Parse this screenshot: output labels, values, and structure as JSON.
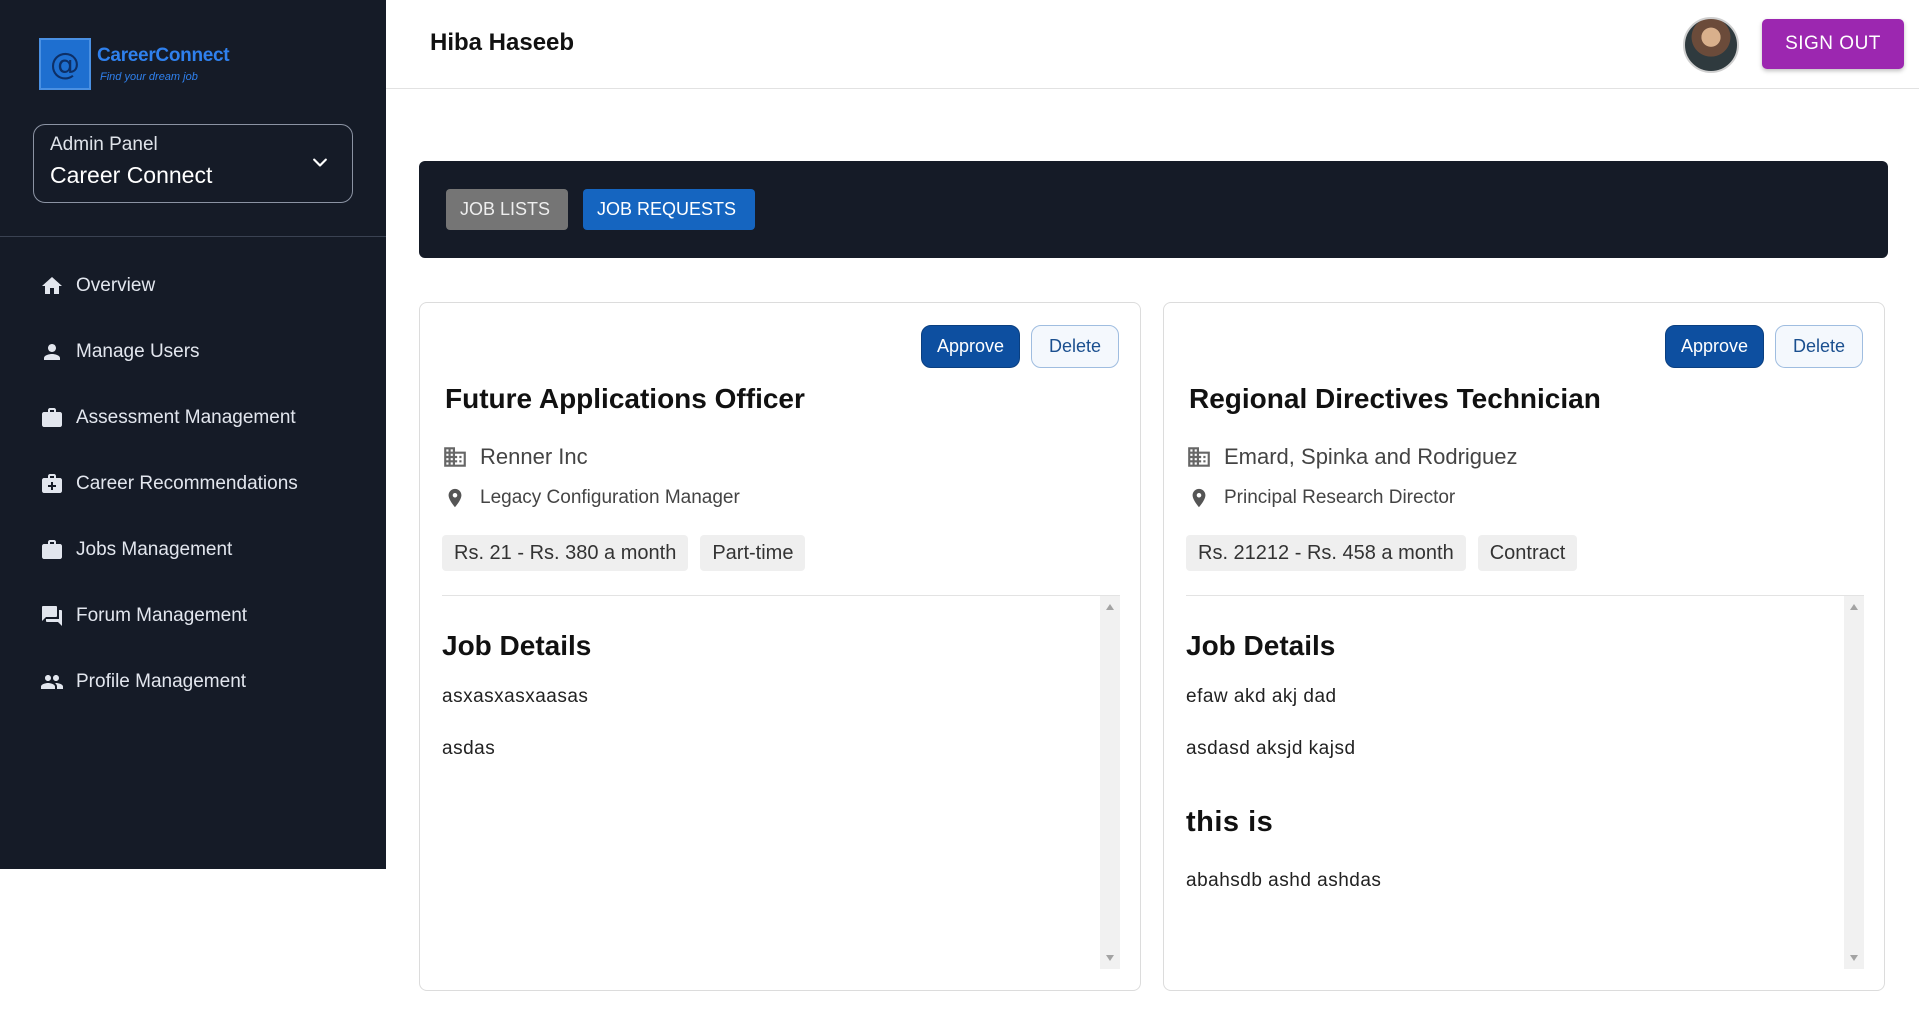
{
  "brand": {
    "logo_symbol": "@",
    "name": "CareerConnect",
    "tagline": "Find your dream job",
    "color": "#2f80ed"
  },
  "panel_select": {
    "small_label": "Admin Panel",
    "value": "Career Connect"
  },
  "sidebar": {
    "items": [
      {
        "label": "Overview",
        "icon": "home-icon"
      },
      {
        "label": "Manage Users",
        "icon": "person-icon"
      },
      {
        "label": "Assessment Management",
        "icon": "briefcase-icon"
      },
      {
        "label": "Career Recommendations",
        "icon": "medical-briefcase-icon"
      },
      {
        "label": "Jobs Management",
        "icon": "briefcase-icon"
      },
      {
        "label": "Forum Management",
        "icon": "forum-icon"
      },
      {
        "label": "Profile Management",
        "icon": "people-icon"
      }
    ]
  },
  "header": {
    "user_name": "Hiba Haseeb",
    "signout_label": "SIGN OUT"
  },
  "tabs": {
    "lists_label": "JOB LISTS",
    "requests_label": "JOB REQUESTS",
    "active": "JOB REQUESTS"
  },
  "jobs": [
    {
      "approve_label": "Approve",
      "delete_label": "Delete",
      "title": "Future Applications Officer",
      "company": "Renner Inc",
      "location": "Legacy Configuration Manager",
      "salary": "Rs. 21 - Rs. 380 a month",
      "type": "Part-time",
      "details_heading": "Job Details",
      "paragraph_1": "asxasxasxaasas",
      "paragraph_2": "asdas"
    },
    {
      "approve_label": "Approve",
      "delete_label": "Delete",
      "title": "Regional Directives Technician",
      "company": "Emard, Spinka and Rodriguez",
      "location": "Principal Research Director",
      "salary": "Rs. 21212 - Rs. 458 a month",
      "type": "Contract",
      "details_heading": "Job Details",
      "paragraph_1": "efaw akd akj dad",
      "paragraph_2": "asdasd aksjd kajsd",
      "subheading": "this is",
      "paragraph_3": "abahsdb ashd ashdas"
    }
  ],
  "colors": {
    "sidebar_bg": "#151b27",
    "signout_bg": "#9c27b0",
    "active_tab": "#1565c0",
    "inactive_tab": "#757575",
    "approve_bg": "#0d4fa0"
  }
}
